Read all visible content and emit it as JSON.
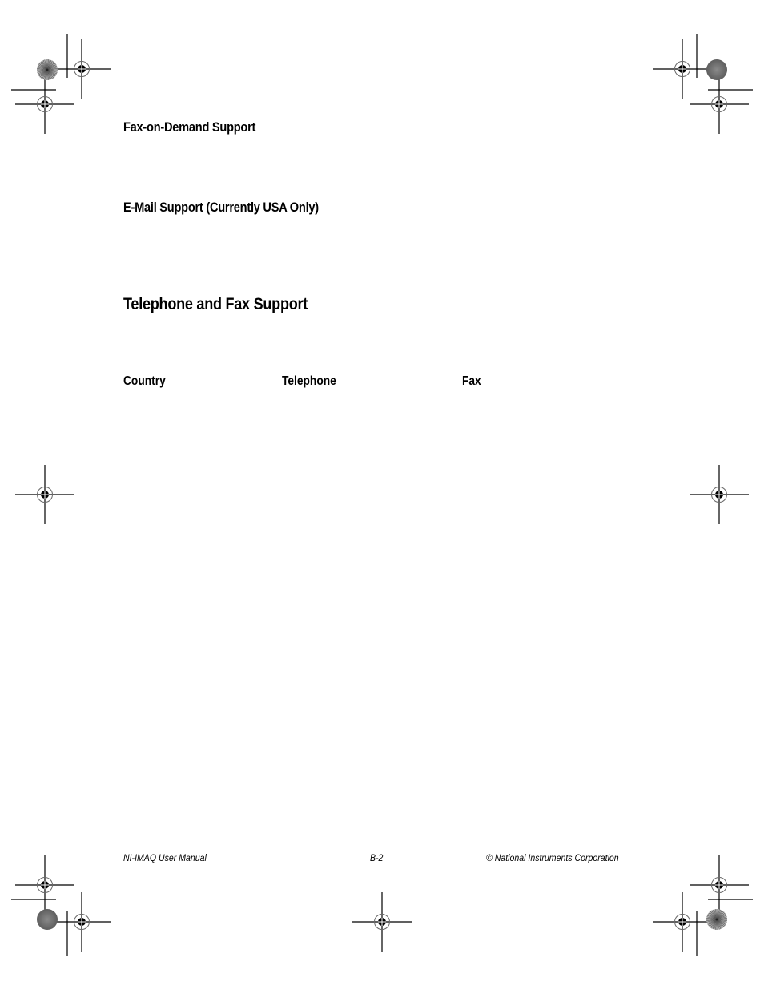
{
  "sections": {
    "fax_on_demand": {
      "heading": "Fax-on-Demand Support"
    },
    "email_support": {
      "heading": "E-Mail Support (Currently USA Only)"
    },
    "telephone_fax": {
      "heading": "Telephone and Fax Support",
      "table": {
        "columns": [
          "Country",
          "Telephone",
          "Fax"
        ],
        "rows": []
      }
    }
  },
  "footer": {
    "left": "NI-IMAQ User Manual",
    "center": "B-2",
    "right": "© National Instruments Corporation"
  },
  "print_marks": {
    "registration_marks": [
      "crosshair-target-icon"
    ],
    "color_bars": [
      "starburst-icon",
      "gray-disc-icon"
    ]
  }
}
